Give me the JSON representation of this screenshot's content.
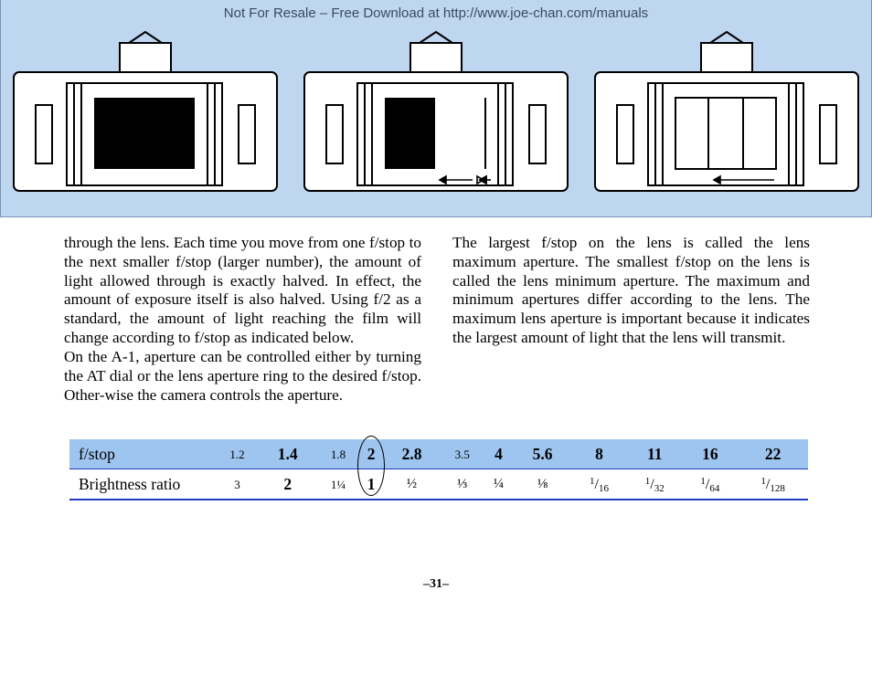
{
  "header": {
    "resale_note": "Not For Resale – Free Download at http://www.joe-chan.com/manuals"
  },
  "paragraphs": {
    "left": "through the lens. Each time you move from one f/stop to the next smaller f/stop (larger number), the amount of light allowed through is exactly halved. In effect, the amount of exposure itself is also halved. Using f/2 as a standard, the amount of light reaching the film will change according to f/stop as indicated below.\nOn the A-1, aperture can be controlled either by turning the AT dial or the lens aperture ring to the desired f/stop. Other-wise the camera controls the aperture.",
    "right": "The largest f/stop on the lens is called the lens maximum aperture. The smallest f/stop on the lens is called the lens minimum aperture. The maximum and minimum apertures differ according to the lens. The maximum lens aperture is important because it indicates the largest amount of light that the lens will transmit."
  },
  "table": {
    "rows": [
      {
        "label": "f/stop",
        "cells": [
          {
            "v": "1.2",
            "cls": "small"
          },
          {
            "v": "1.4",
            "cls": "bold"
          },
          {
            "v": "1.8",
            "cls": "small"
          },
          {
            "v": "2",
            "cls": "bold"
          },
          {
            "v": "2.8",
            "cls": "bold"
          },
          {
            "v": "3.5",
            "cls": "small"
          },
          {
            "v": "4",
            "cls": "bold"
          },
          {
            "v": "5.6",
            "cls": "bold"
          },
          {
            "v": "8",
            "cls": "bold"
          },
          {
            "v": "11",
            "cls": "bold"
          },
          {
            "v": "16",
            "cls": "bold"
          },
          {
            "v": "22",
            "cls": "bold"
          }
        ]
      },
      {
        "label": "Brightness ratio",
        "cells": [
          {
            "v": "3",
            "cls": "small"
          },
          {
            "v": "2",
            "cls": "bold"
          },
          {
            "v": "1¼",
            "cls": "small"
          },
          {
            "v": "1",
            "cls": "bold"
          },
          {
            "v": "½",
            "cls": "frac"
          },
          {
            "v": "⅓",
            "cls": "frac"
          },
          {
            "v": "¼",
            "cls": "frac"
          },
          {
            "v": "⅛",
            "cls": "frac"
          },
          {
            "num": "1",
            "den": "16"
          },
          {
            "num": "1",
            "den": "32"
          },
          {
            "num": "1",
            "den": "64"
          },
          {
            "num": "1",
            "den": "128"
          }
        ]
      }
    ],
    "circled_column_index": 3
  },
  "page_number": "–31–"
}
